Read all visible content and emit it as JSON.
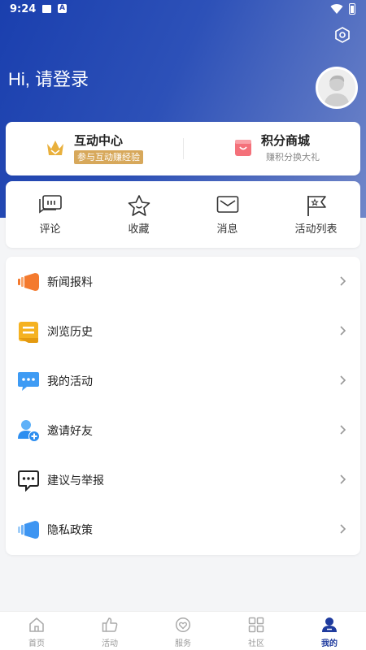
{
  "status_bar": {
    "time": "9:24",
    "notif_letter": "A"
  },
  "header": {
    "greeting": "Hi, 请登录"
  },
  "top_cards": [
    {
      "title": "互动中心",
      "subtitle": "参与互动赚经验",
      "icon": "crown-icon"
    },
    {
      "title": "积分商城",
      "subtitle": "赚积分换大礼",
      "icon": "shopping-bag-icon"
    }
  ],
  "quick_actions": [
    {
      "label": "评论",
      "icon": "comment-icon"
    },
    {
      "label": "收藏",
      "icon": "star-icon"
    },
    {
      "label": "消息",
      "icon": "mail-icon"
    },
    {
      "label": "活动列表",
      "icon": "flag-icon"
    }
  ],
  "menu_items": [
    {
      "label": "新闻报料",
      "icon": "megaphone-icon",
      "color": "#f47a2e"
    },
    {
      "label": "浏览历史",
      "icon": "history-icon",
      "color": "#f5b221"
    },
    {
      "label": "我的活动",
      "icon": "chat-bubble-icon",
      "color": "#3e9bf4"
    },
    {
      "label": "邀请好友",
      "icon": "add-user-icon",
      "color": "#2d8ef0"
    },
    {
      "label": "建议与举报",
      "icon": "feedback-icon",
      "color": "#222222"
    },
    {
      "label": "隐私政策",
      "icon": "privacy-icon",
      "color": "#3d95f2"
    }
  ],
  "tab_bar": [
    {
      "label": "首页",
      "icon": "home-icon",
      "active": false
    },
    {
      "label": "活动",
      "icon": "thumbs-up-icon",
      "active": false
    },
    {
      "label": "服务",
      "icon": "service-icon",
      "active": false
    },
    {
      "label": "社区",
      "icon": "grid-icon",
      "active": false
    },
    {
      "label": "我的",
      "icon": "user-icon",
      "active": true
    }
  ],
  "colors": {
    "brand": "#1f3b9e",
    "hero_start": "#1a3fae",
    "hero_end": "#7187c9",
    "accent_gold": "#d7a85b"
  }
}
